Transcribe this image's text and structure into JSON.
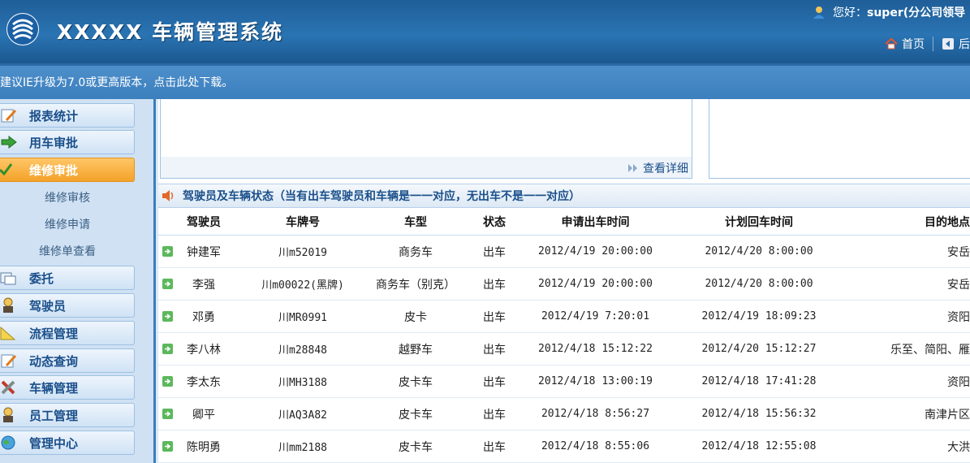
{
  "header": {
    "title": "XXXXX 车辆管理系统",
    "greeting": "您好：",
    "user": "super(分公司领导",
    "nav": [
      {
        "label": "首页",
        "icon": "home-icon"
      },
      {
        "label": "后",
        "icon": "back-icon"
      }
    ]
  },
  "notice": "建议IE升级为7.0或更高版本，点击此处下载。",
  "sidebar": {
    "items": [
      {
        "label": "报表统计",
        "icon": "report-icon",
        "active": false
      },
      {
        "label": "用车审批",
        "icon": "arrow-right-icon",
        "active": false
      },
      {
        "label": "维修审批",
        "icon": "checkmark-icon",
        "active": true
      },
      {
        "label": "委托",
        "icon": "delegate-icon",
        "active": false
      },
      {
        "label": "驾驶员",
        "icon": "driver-icon",
        "active": false
      },
      {
        "label": "流程管理",
        "icon": "ruler-icon",
        "active": false
      },
      {
        "label": "动态查询",
        "icon": "edit-icon",
        "active": false
      },
      {
        "label": "车辆管理",
        "icon": "tools-icon",
        "active": false
      },
      {
        "label": "员工管理",
        "icon": "staff-icon",
        "active": false
      },
      {
        "label": "管理中心",
        "icon": "globe-icon",
        "active": false
      }
    ],
    "sub_items": [
      "维修审核",
      "维修申请",
      "维修单查看"
    ]
  },
  "main": {
    "detail_link": "查看详细",
    "section_title": "驾驶员及车辆状态（当有出车驾驶员和车辆是一一对应，无出车不是一一对应）",
    "columns": [
      "驾驶员",
      "车牌号",
      "车型",
      "状态",
      "申请出车时间",
      "计划回车时间",
      "目的地点"
    ],
    "rows": [
      [
        "钟建军",
        "川m52019",
        "商务车",
        "出车",
        "2012/4/19 20:00:00",
        "2012/4/20 8:00:00",
        "安岳"
      ],
      [
        "李强",
        "川m00022(黑牌)",
        "商务车（别克）",
        "出车",
        "2012/4/19 20:00:00",
        "2012/4/20 8:00:00",
        "安岳"
      ],
      [
        "邓勇",
        "川MR0991",
        "皮卡",
        "出车",
        "2012/4/19 7:20:01",
        "2012/4/19 18:09:23",
        "资阳"
      ],
      [
        "李八林",
        "川m28848",
        "越野车",
        "出车",
        "2012/4/18 15:12:22",
        "2012/4/20 15:12:27",
        "乐至、简阳、雁"
      ],
      [
        "李太东",
        "川MH3188",
        "皮卡车",
        "出车",
        "2012/4/18 13:00:19",
        "2012/4/18 17:41:28",
        "资阳"
      ],
      [
        "卿平",
        "川AQ3A82",
        "皮卡车",
        "出车",
        "2012/4/18 8:56:27",
        "2012/4/18 15:56:32",
        "南津片区"
      ],
      [
        "陈明勇",
        "川mm2188",
        "皮卡车",
        "出车",
        "2012/4/18 8:55:06",
        "2012/4/18 12:55:08",
        "大洪"
      ]
    ]
  }
}
